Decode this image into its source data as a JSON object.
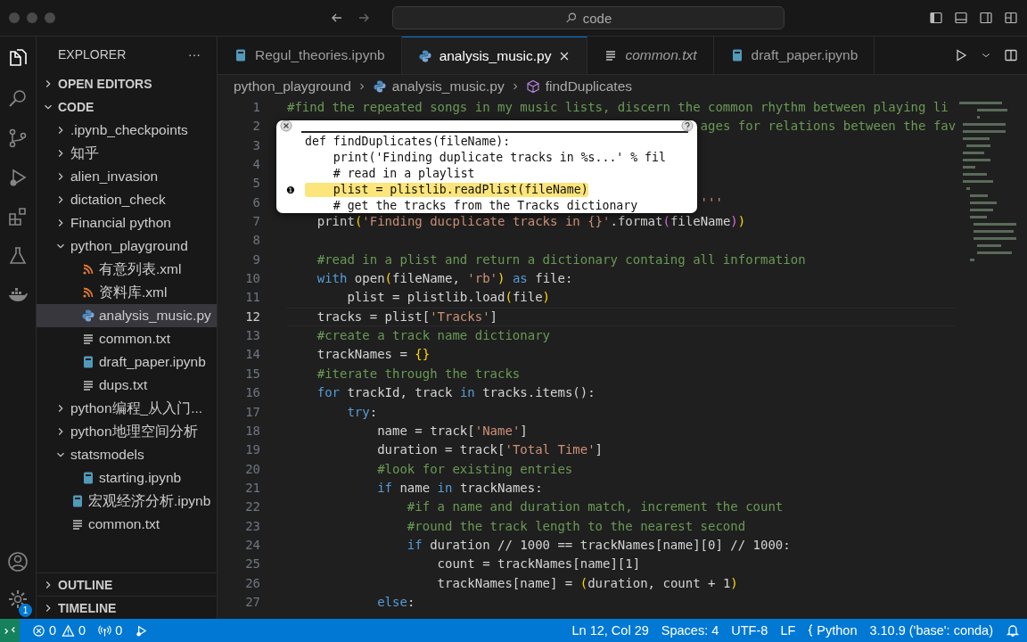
{
  "titlebar": {
    "search": "code"
  },
  "activity_badge": "1",
  "sidebar": {
    "title": "EXPLORER",
    "more": "···",
    "sections_top": [
      {
        "label": "OPEN EDITORS",
        "expanded": false
      }
    ],
    "root": {
      "label": "CODE",
      "expanded": true
    },
    "tree": [
      {
        "label": ".ipynb_checkpoints",
        "kind": "folder",
        "expanded": false,
        "selected": false
      },
      {
        "label": "知乎",
        "kind": "folder",
        "expanded": false,
        "selected": false
      },
      {
        "label": "alien_invasion",
        "kind": "folder",
        "expanded": false,
        "selected": false
      },
      {
        "label": "dictation_check",
        "kind": "folder",
        "expanded": false,
        "selected": false
      },
      {
        "label": "Financial python",
        "kind": "folder",
        "expanded": false,
        "selected": false
      },
      {
        "label": "python_playground",
        "kind": "folder",
        "expanded": true,
        "selected": false,
        "children": [
          {
            "label": "有意列表.xml",
            "kind": "xml",
            "selected": false
          },
          {
            "label": "资料库.xml",
            "kind": "xml",
            "selected": false
          },
          {
            "label": "analysis_music.py",
            "kind": "python",
            "selected": true
          },
          {
            "label": "common.txt",
            "kind": "text",
            "selected": false
          },
          {
            "label": "draft_paper.ipynb",
            "kind": "notebook",
            "selected": false
          },
          {
            "label": "dups.txt",
            "kind": "text",
            "selected": false
          }
        ]
      },
      {
        "label": "python编程_从入门...",
        "kind": "folder",
        "expanded": false,
        "selected": false
      },
      {
        "label": "python地理空间分析",
        "kind": "folder",
        "expanded": false,
        "selected": false
      },
      {
        "label": "statsmodels",
        "kind": "folder",
        "expanded": true,
        "selected": false,
        "children": [
          {
            "label": "starting.ipynb",
            "kind": "notebook",
            "selected": false
          }
        ]
      },
      {
        "label": "宏观经济分析.ipynb",
        "kind": "notebook",
        "selected": false
      },
      {
        "label": "common.txt",
        "kind": "text",
        "selected": false
      }
    ],
    "sections_bottom": [
      {
        "label": "OUTLINE",
        "expanded": false
      },
      {
        "label": "TIMELINE",
        "expanded": false
      }
    ]
  },
  "tabs": [
    {
      "label": "Regul_theories.ipynb",
      "kind": "notebook",
      "selected": false,
      "preview": false
    },
    {
      "label": "analysis_music.py",
      "kind": "python",
      "selected": true,
      "preview": false
    },
    {
      "label": "common.txt",
      "kind": "text",
      "selected": false,
      "preview": true
    },
    {
      "label": "draft_paper.ipynb",
      "kind": "notebook",
      "selected": false,
      "preview": false
    }
  ],
  "breadcrumb": [
    {
      "label": "python_playground",
      "kind": "folder"
    },
    {
      "label": "analysis_music.py",
      "kind": "python"
    },
    {
      "label": "findDuplicates",
      "kind": "symbol"
    }
  ],
  "lines": [
    {
      "number": "1",
      "current": false,
      "tokens": [
        {
          "kind": "comment",
          "text": "#find the repeated songs in my music lists, discern the common rhythm between playing li"
        }
      ]
    },
    {
      "number": "2",
      "current": false,
      "tokens": [
        {
          "kind": "comment",
          "text": "                                                       ages for relations between the fav"
        }
      ]
    },
    {
      "number": "3",
      "current": false
    },
    {
      "number": "4",
      "current": false
    },
    {
      "number": "5",
      "current": false
    },
    {
      "number": "6",
      "current": false,
      "tokens": [
        {
          "kind": "string",
          "text": "                                                       '''"
        }
      ]
    },
    {
      "number": "7",
      "current": false,
      "tokens": [
        {
          "kind": "text",
          "text": "    print"
        },
        {
          "kind": "bracket",
          "text": "("
        },
        {
          "kind": "string",
          "text": "'Finding ducplicate tracks in {}'"
        },
        {
          "kind": "text",
          "text": ".format"
        },
        {
          "kind": "bracket2",
          "text": "("
        },
        {
          "kind": "text",
          "text": "fileName"
        },
        {
          "kind": "bracket2",
          "text": ")"
        },
        {
          "kind": "bracket",
          "text": ")"
        }
      ]
    },
    {
      "number": "8",
      "current": false
    },
    {
      "number": "9",
      "current": false,
      "tokens": [
        {
          "kind": "comment",
          "text": "    #read in a plist and return a dictionary containg all information"
        }
      ]
    },
    {
      "number": "10",
      "current": false,
      "tokens": [
        {
          "kind": "keyword",
          "text": "    with"
        },
        {
          "kind": "text",
          "text": " open"
        },
        {
          "kind": "bracket",
          "text": "("
        },
        {
          "kind": "text",
          "text": "fileName, "
        },
        {
          "kind": "string",
          "text": "'rb'"
        },
        {
          "kind": "bracket",
          "text": ")"
        },
        {
          "kind": "keyword",
          "text": " as"
        },
        {
          "kind": "text",
          "text": " file:"
        }
      ]
    },
    {
      "number": "11",
      "current": false,
      "tokens": [
        {
          "kind": "text",
          "text": "        plist = plistlib.load"
        },
        {
          "kind": "bracket",
          "text": "("
        },
        {
          "kind": "text",
          "text": "file"
        },
        {
          "kind": "bracket",
          "text": ")"
        }
      ]
    },
    {
      "number": "12",
      "current": true,
      "tokens": [
        {
          "kind": "text",
          "text": "    tracks = plist["
        },
        {
          "kind": "string",
          "text": "'Tracks'"
        },
        {
          "kind": "text",
          "text": "]"
        }
      ]
    },
    {
      "number": "13",
      "current": false,
      "tokens": [
        {
          "kind": "comment",
          "text": "    #create a track name dictionary"
        }
      ]
    },
    {
      "number": "14",
      "current": false,
      "tokens": [
        {
          "kind": "text",
          "text": "    trackNames = "
        },
        {
          "kind": "bracket",
          "text": "{}"
        }
      ]
    },
    {
      "number": "15",
      "current": false,
      "tokens": [
        {
          "kind": "comment",
          "text": "    #iterate through the tracks"
        }
      ]
    },
    {
      "number": "16",
      "current": false,
      "tokens": [
        {
          "kind": "keyword",
          "text": "    for"
        },
        {
          "kind": "text",
          "text": " trackId, track "
        },
        {
          "kind": "keyword",
          "text": "in"
        },
        {
          "kind": "text",
          "text": " tracks.items():"
        }
      ]
    },
    {
      "number": "17",
      "current": false,
      "tokens": [
        {
          "kind": "keyword",
          "text": "        try"
        },
        {
          "kind": "text",
          "text": ":"
        }
      ]
    },
    {
      "number": "18",
      "current": false,
      "tokens": [
        {
          "kind": "text",
          "text": "            name = track["
        },
        {
          "kind": "string",
          "text": "'Name'"
        },
        {
          "kind": "text",
          "text": "]"
        }
      ]
    },
    {
      "number": "19",
      "current": false,
      "tokens": [
        {
          "kind": "text",
          "text": "            duration = track["
        },
        {
          "kind": "string",
          "text": "'Total Time'"
        },
        {
          "kind": "text",
          "text": "]"
        }
      ]
    },
    {
      "number": "20",
      "current": false,
      "tokens": [
        {
          "kind": "comment",
          "text": "            #look for existing entries"
        }
      ]
    },
    {
      "number": "21",
      "current": false,
      "tokens": [
        {
          "kind": "keyword",
          "text": "            if"
        },
        {
          "kind": "text",
          "text": " name "
        },
        {
          "kind": "keyword",
          "text": "in"
        },
        {
          "kind": "text",
          "text": " trackNames:"
        }
      ]
    },
    {
      "number": "22",
      "current": false,
      "tokens": [
        {
          "kind": "comment",
          "text": "                #if a name and duration match, increment the count"
        }
      ]
    },
    {
      "number": "23",
      "current": false,
      "tokens": [
        {
          "kind": "comment",
          "text": "                #round the track length to the nearest second"
        }
      ]
    },
    {
      "number": "24",
      "current": false,
      "tokens": [
        {
          "kind": "keyword",
          "text": "                if"
        },
        {
          "kind": "text",
          "text": " duration // 1000 == trackNames[name][0] // 1000:"
        }
      ]
    },
    {
      "number": "25",
      "current": false,
      "tokens": [
        {
          "kind": "text",
          "text": "                    count = trackNames[name][1]"
        }
      ]
    },
    {
      "number": "26",
      "current": false,
      "tokens": [
        {
          "kind": "text",
          "text": "                    trackNames[name] = "
        },
        {
          "kind": "bracket",
          "text": "("
        },
        {
          "kind": "text",
          "text": "duration, count + 1"
        },
        {
          "kind": "bracket",
          "text": ")"
        }
      ]
    },
    {
      "number": "27",
      "current": false,
      "tokens": [
        {
          "kind": "keyword",
          "text": "            else"
        },
        {
          "kind": "text",
          "text": ":"
        }
      ]
    }
  ],
  "popup": {
    "marker": "❶",
    "lines": [
      {
        "text": "def findDuplicates(fileName):",
        "highlighted": false
      },
      {
        "text": "    print('Finding duplicate tracks in %s...' % fil",
        "highlighted": false
      },
      {
        "text": "    # read in a playlist",
        "highlighted": false
      },
      {
        "text": "    plist = plistlib.readPlist(fileName)",
        "highlighted": true
      },
      {
        "text": "    # get the tracks from the Tracks dictionary",
        "highlighted": false
      }
    ]
  },
  "status_bar": [
    {
      "kind": "errors",
      "text": "0"
    },
    {
      "kind": "warnings",
      "text": "0"
    },
    {
      "kind": "ports",
      "text": "0"
    },
    {
      "kind": "debug"
    },
    {
      "kind": "spacer"
    },
    {
      "kind": "plain",
      "text": "Ln 12, Col 29"
    },
    {
      "kind": "plain",
      "text": "Spaces: 4"
    },
    {
      "kind": "plain",
      "text": "UTF-8"
    },
    {
      "kind": "plain",
      "text": "LF"
    },
    {
      "kind": "language",
      "text": "Python"
    },
    {
      "kind": "plain",
      "text": "3.10.9 ('base': conda)"
    },
    {
      "kind": "bell"
    }
  ]
}
